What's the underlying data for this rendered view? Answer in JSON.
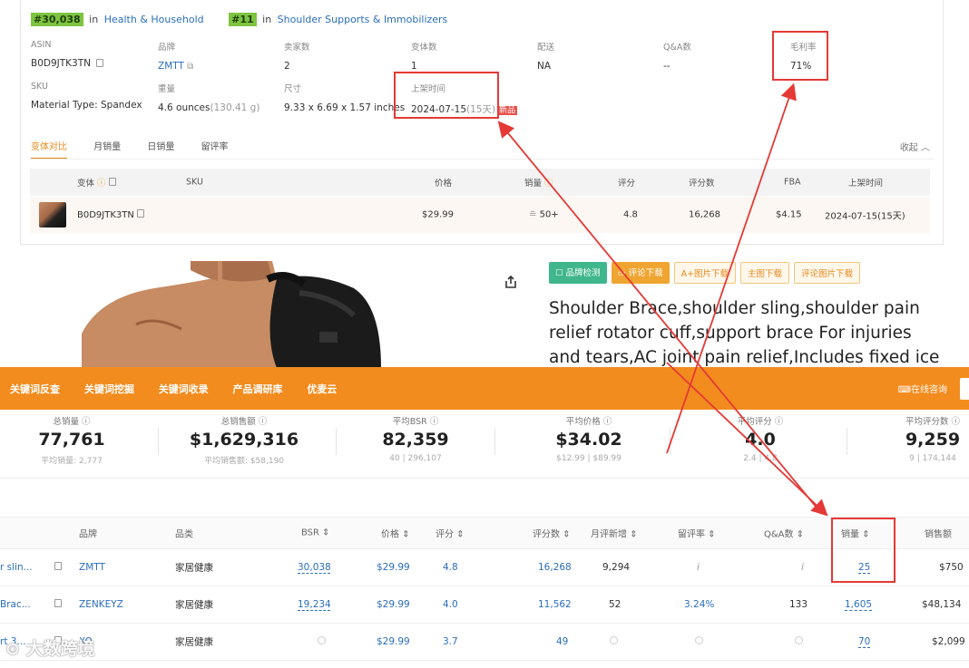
{
  "rank": {
    "primary_rank": "#30,038",
    "primary_in": "in",
    "primary_category": "Health & Household",
    "secondary_rank": "#11",
    "secondary_in": "in",
    "secondary_category": "Shoulder Supports & Immobilizers"
  },
  "info": {
    "asin_label": "ASIN",
    "asin_value": "B0D9JTK3TN",
    "brand_label": "品牌",
    "brand_value": "ZMTT",
    "sellers_label": "卖家数",
    "sellers_value": "2",
    "variants_label": "变体数",
    "variants_value": "1",
    "shipping_label": "配送",
    "shipping_value": "NA",
    "qa_label": "Q&A数",
    "qa_value": "--",
    "margin_label": "毛利率",
    "margin_value": "71%",
    "sku_label": "SKU",
    "sku_value": "Material Type: Spandex",
    "weight_label": "重量",
    "weight_value": "4.6 ounces",
    "weight_extra": "(130.41 g)",
    "size_label": "尺寸",
    "size_value": "9.33 x 6.69 x 1.57 inches",
    "listed_label": "上架时间",
    "listed_value": "2024-07-15",
    "listed_extra": "(15天)",
    "new_tag": "新品"
  },
  "tabs": [
    "变体对比",
    "月销量",
    "日销量",
    "留评率"
  ],
  "collapse": "收起",
  "variant_table": {
    "headers": {
      "variant": "变体",
      "sku": "SKU",
      "price": "价格",
      "sales": "销量",
      "rating": "评分",
      "reviews": "评分数",
      "fba": "FBA",
      "listed": "上架时间"
    },
    "row": {
      "asin": "B0D9JTK3TN",
      "price": "$29.99",
      "sales": "50+",
      "rating": "4.8",
      "reviews": "16,268",
      "fba": "$4.15",
      "listed": "2024-07-15(15天)"
    }
  },
  "action_buttons": [
    "品牌检测",
    "评论下载",
    "A+图片下载",
    "主图下载",
    "评论图片下载"
  ],
  "product_title": "Shoulder Brace,shoulder sling,shoulder pain relief rotator cuff,support brace For injuries and tears,AC joint pain relief,Includes fixed ice",
  "toolbar": {
    "nav": [
      "关键词反查",
      "关键词挖掘",
      "关键词收录",
      "产品调研库",
      "优麦云"
    ],
    "consult": "在线咨询"
  },
  "stats": [
    {
      "label": "总销量",
      "value": "77,761",
      "sub": "平均销量: 2,777"
    },
    {
      "label": "总销售额",
      "value": "$1,629,316",
      "sub": "平均销售额: $58,190"
    },
    {
      "label": "平均BSR",
      "value": "82,359",
      "sub": "40 | 296,107"
    },
    {
      "label": "平均价格",
      "value": "$34.02",
      "sub": "$12.99 | $89.99"
    },
    {
      "label": "平均评分",
      "value": "4.0",
      "sub": "2.4 | 4.8"
    },
    {
      "label": "平均评分数",
      "value": "9,259",
      "sub": "9 | 174,144"
    }
  ],
  "product_table": {
    "headers": {
      "brand": "品牌",
      "category": "品类",
      "bsr": "BSR",
      "price": "价格",
      "rating": "评分",
      "reviews": "评分数",
      "monthly_new": "月评新增",
      "review_rate": "留评率",
      "qa": "Q&A数",
      "sales": "销量",
      "revenue": "销售额"
    },
    "rows": [
      {
        "title": "r slin...",
        "brand": "ZMTT",
        "category": "家居健康",
        "bsr": "30,038",
        "price": "$29.99",
        "rating": "4.8",
        "reviews": "16,268",
        "monthly_new": "9,294",
        "review_rate": "i",
        "qa": "i",
        "sales": "25",
        "revenue": "$750"
      },
      {
        "title": "Brac...",
        "brand": "ZENKEYZ",
        "category": "家居健康",
        "bsr": "19,234",
        "price": "$29.99",
        "rating": "4.0",
        "reviews": "11,562",
        "monthly_new": "52",
        "review_rate": "3.24%",
        "qa": "133",
        "sales": "1,605",
        "revenue": "$48,134"
      },
      {
        "title": "rt 3...",
        "brand": "XO",
        "category": "家居健康",
        "bsr": "",
        "price": "$29.99",
        "rating": "3.7",
        "reviews": "49",
        "monthly_new": "",
        "review_rate": "",
        "qa": "",
        "sales": "70",
        "revenue": "$2,099"
      }
    ]
  },
  "watermark": "大数跨境",
  "colors": {
    "accent": "#f28c1e",
    "link": "#2a6ebb",
    "annotation": "#e53935",
    "badge": "#7ec440"
  }
}
